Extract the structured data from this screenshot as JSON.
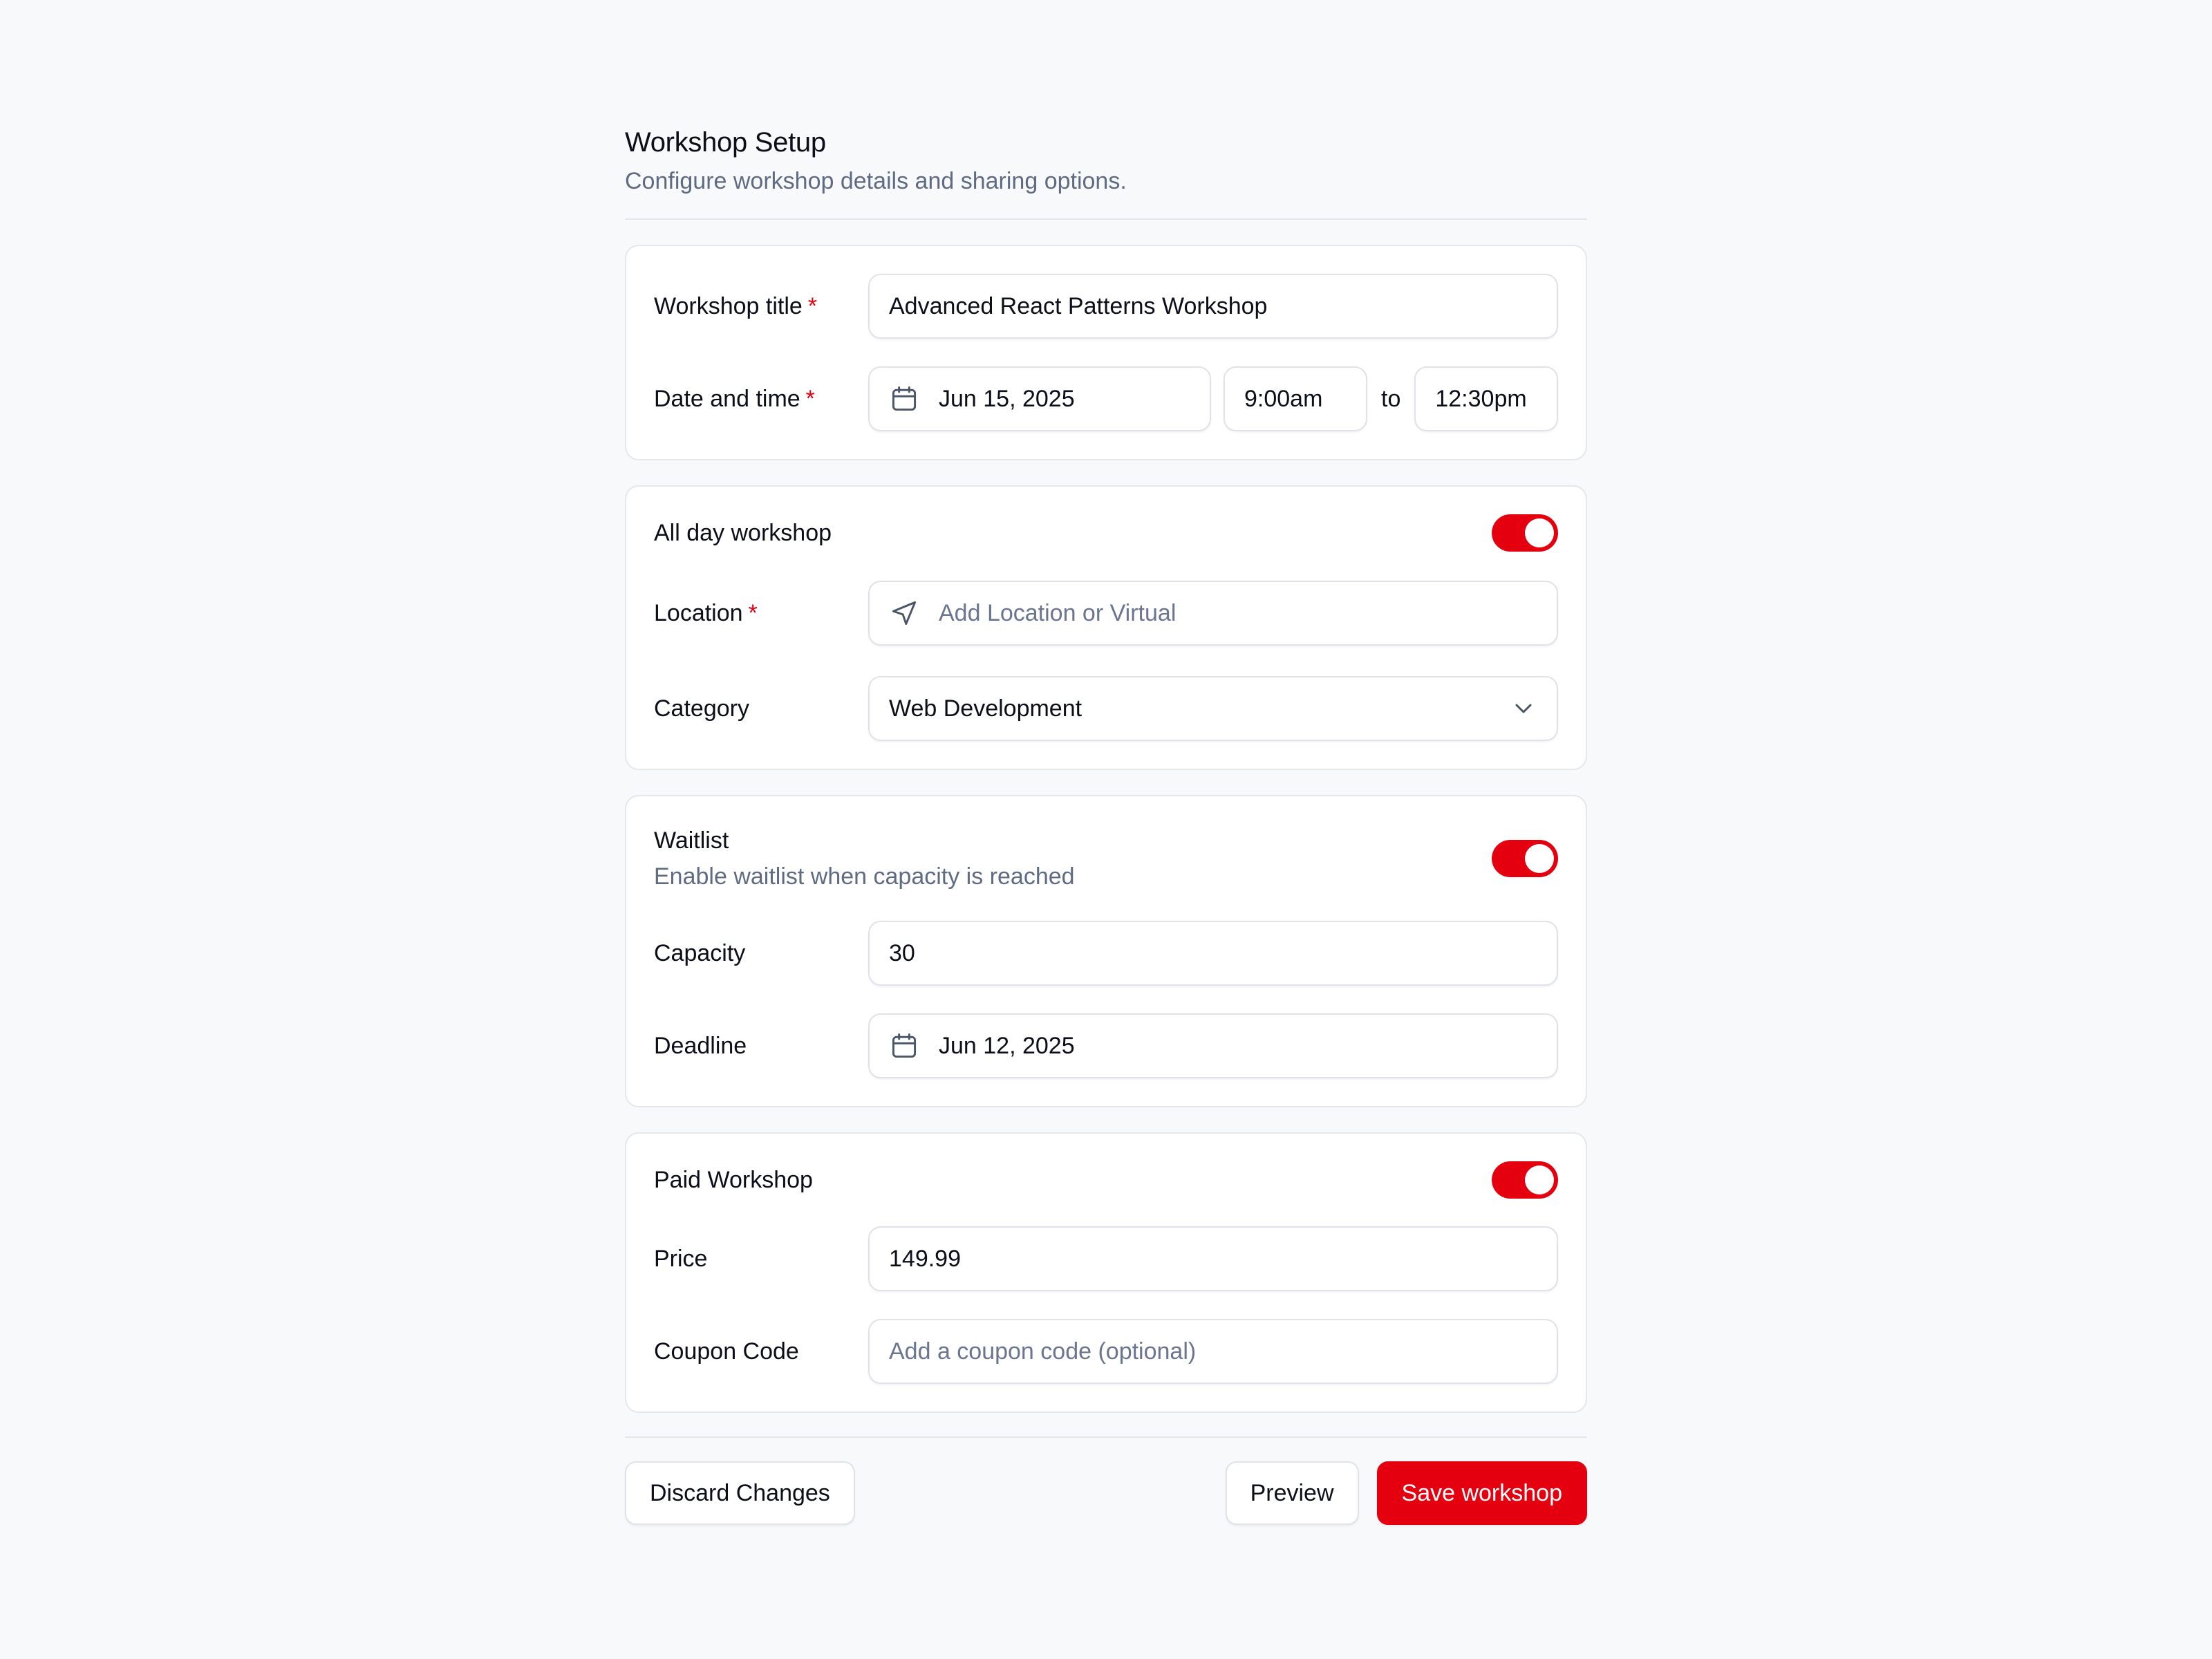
{
  "header": {
    "title": "Workshop Setup",
    "subtitle": "Configure workshop details and sharing options."
  },
  "details": {
    "title_label": "Workshop title",
    "title_value": "Advanced React Patterns Workshop",
    "datetime_label": "Date and time",
    "date_value": "Jun 15, 2025",
    "start_time": "9:00am",
    "to_label": "to",
    "end_time": "12:30pm",
    "required_mark": "*"
  },
  "allday": {
    "toggle_label": "All day workshop",
    "toggle_on": true,
    "location_label": "Location",
    "location_placeholder": "Add Location or Virtual",
    "category_label": "Category",
    "category_value": "Web Development"
  },
  "waitlist": {
    "toggle_label": "Waitlist",
    "toggle_sub": "Enable waitlist when capacity is reached",
    "toggle_on": true,
    "capacity_label": "Capacity",
    "capacity_value": "30",
    "deadline_label": "Deadline",
    "deadline_value": "Jun 12, 2025"
  },
  "paid": {
    "toggle_label": "Paid Workshop",
    "toggle_on": true,
    "price_label": "Price",
    "price_value": "149.99",
    "coupon_label": "Coupon Code",
    "coupon_placeholder": "Add a coupon code (optional)"
  },
  "footer": {
    "discard_label": "Discard Changes",
    "preview_label": "Preview",
    "save_label": "Save workshop"
  },
  "colors": {
    "accent": "#e5000f",
    "muted_text": "#5f6b82",
    "border": "#e4e7ec",
    "background": "#f8f9fb"
  },
  "icons": {
    "calendar": "calendar-icon",
    "location": "navigation-arrow-icon",
    "dropdown": "chevron-down-icon"
  }
}
